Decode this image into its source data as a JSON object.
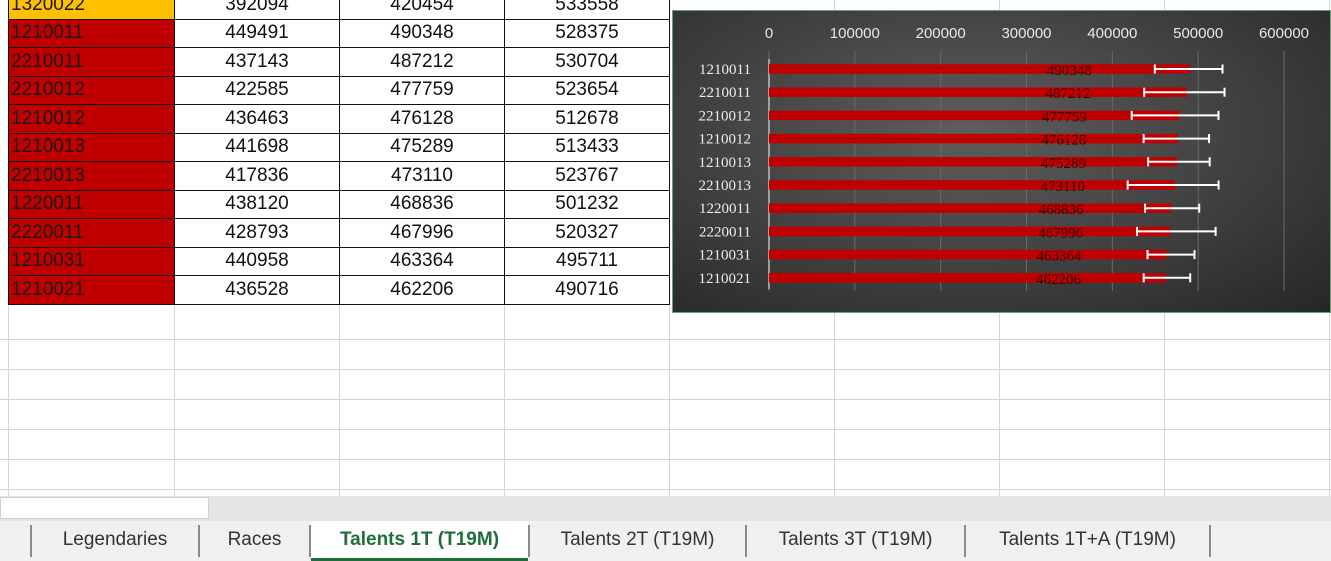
{
  "table": {
    "partial_first_row": {
      "id": "1320022",
      "v1": "392094",
      "v2": "420454",
      "v3": "533558"
    },
    "rows": [
      {
        "id": "1210011",
        "v1": "449491",
        "v2": "490348",
        "v3": "528375"
      },
      {
        "id": "2210011",
        "v1": "437143",
        "v2": "487212",
        "v3": "530704"
      },
      {
        "id": "2210012",
        "v1": "422585",
        "v2": "477759",
        "v3": "523654"
      },
      {
        "id": "1210012",
        "v1": "436463",
        "v2": "476128",
        "v3": "512678"
      },
      {
        "id": "1210013",
        "v1": "441698",
        "v2": "475289",
        "v3": "513433"
      },
      {
        "id": "2210013",
        "v1": "417836",
        "v2": "473110",
        "v3": "523767"
      },
      {
        "id": "1220011",
        "v1": "438120",
        "v2": "468836",
        "v3": "501232"
      },
      {
        "id": "2220011",
        "v1": "428793",
        "v2": "467996",
        "v3": "520327"
      },
      {
        "id": "1210031",
        "v1": "440958",
        "v2": "463364",
        "v3": "495711"
      },
      {
        "id": "1210021",
        "v1": "436528",
        "v2": "462206",
        "v3": "490716"
      }
    ]
  },
  "colors": {
    "id_cell": "#c00000",
    "first_id_cell": "#ffc000",
    "bar": "#c00000",
    "active_tab": "#1e6e3c"
  },
  "chart_data": {
    "type": "bar",
    "orientation": "horizontal",
    "categories": [
      "1210011",
      "2210011",
      "2210012",
      "1210012",
      "1210013",
      "2210013",
      "1220011",
      "2220011",
      "1210031",
      "1210021"
    ],
    "series": [
      {
        "values": [
          490348,
          487212,
          477759,
          476128,
          475289,
          473110,
          468836,
          467996,
          463364,
          462206
        ],
        "error_low": [
          449491,
          437143,
          422585,
          436463,
          441698,
          417836,
          438120,
          428793,
          440958,
          436528
        ],
        "error_high": [
          528375,
          530704,
          523654,
          512678,
          513433,
          523767,
          501232,
          520327,
          495711,
          490716
        ]
      }
    ],
    "data_labels": [
      "490348",
      "487212",
      "477759",
      "476128",
      "475289",
      "473110",
      "468836",
      "467996",
      "463364",
      "462206"
    ],
    "x_ticks": [
      "0",
      "100000",
      "200000",
      "300000",
      "400000",
      "500000",
      "600000"
    ],
    "xlim": [
      0,
      600000
    ],
    "axis_position": "top",
    "grid": true,
    "title": "",
    "xlabel": "",
    "ylabel": ""
  },
  "tabs": [
    {
      "label": "Legendaries",
      "active": false
    },
    {
      "label": "Races",
      "active": false
    },
    {
      "label": "Talents 1T (T19M)",
      "active": true
    },
    {
      "label": "Talents 2T (T19M)",
      "active": false
    },
    {
      "label": "Talents 3T (T19M)",
      "active": false
    },
    {
      "label": "Talents 1T+A (T19M)",
      "active": false
    }
  ]
}
